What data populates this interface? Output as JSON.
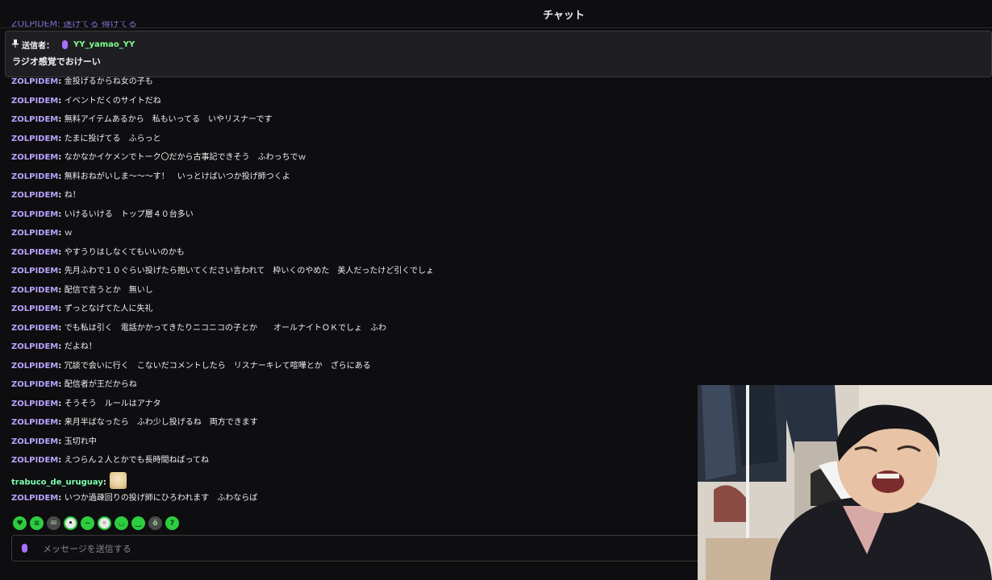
{
  "header": {
    "title": "チャット"
  },
  "clipped_top": "ZOLPIDEM: 迷げてる 得げてる",
  "pinned": {
    "icon": "pin-icon",
    "label": "送信者：",
    "username": "YY_yamao_YY",
    "message": "ラジオ感覚でおけーい"
  },
  "colors": {
    "zolpidem": "#b9a3ff",
    "trabuco": "#7dffb0",
    "pinned_user": "#7dff8b"
  },
  "messages": [
    {
      "user": "ZOLPIDEM",
      "text": "金投げるからね女の子も",
      "color": "#b9a3ff"
    },
    {
      "user": "ZOLPIDEM",
      "text": "イベントだくのサイトだね",
      "color": "#b9a3ff"
    },
    {
      "user": "ZOLPIDEM",
      "text": "無料アイテムあるから　私もいってる　いやリスナーです",
      "color": "#b9a3ff"
    },
    {
      "user": "ZOLPIDEM",
      "text": "たまに投げてる　ふらっと",
      "color": "#b9a3ff"
    },
    {
      "user": "ZOLPIDEM",
      "text": "なかなかイケメンでトーク〇だから古事記できそう　ふわっちでｗ",
      "color": "#b9a3ff"
    },
    {
      "user": "ZOLPIDEM",
      "text": "無料おねがいしま〜〜〜す！　いっとけばいつか投げ師つくよ",
      "color": "#b9a3ff"
    },
    {
      "user": "ZOLPIDEM",
      "text": "ね！",
      "color": "#b9a3ff"
    },
    {
      "user": "ZOLPIDEM",
      "text": "いけるいける　トップ層４０台多い",
      "color": "#b9a3ff"
    },
    {
      "user": "ZOLPIDEM",
      "text": "ｗ",
      "color": "#b9a3ff"
    },
    {
      "user": "ZOLPIDEM",
      "text": "やすうりはしなくてもいいのかも",
      "color": "#b9a3ff"
    },
    {
      "user": "ZOLPIDEM",
      "text": "先月ふわで１０ぐらい投げたら抱いてください言われて　枠いくのやめた　美人だったけど引くでしょ",
      "color": "#b9a3ff"
    },
    {
      "user": "ZOLPIDEM",
      "text": "配信で言うとか　無いし",
      "color": "#b9a3ff"
    },
    {
      "user": "ZOLPIDEM",
      "text": "ずっとなげてた人に失礼",
      "color": "#b9a3ff"
    },
    {
      "user": "ZOLPIDEM",
      "text": "でも私は引く　電話かかってきたりニコニコの子とか　　オールナイトＯＫでしょ　ふわ",
      "color": "#b9a3ff"
    },
    {
      "user": "ZOLPIDEM",
      "text": "だよね！",
      "color": "#b9a3ff"
    },
    {
      "user": "ZOLPIDEM",
      "text": "冗談で会いに行く　こないだコメントしたら　リスナーキレて喧嘩とか　ざらにある",
      "color": "#b9a3ff"
    },
    {
      "user": "ZOLPIDEM",
      "text": "配信者が王だからね",
      "color": "#b9a3ff"
    },
    {
      "user": "ZOLPIDEM",
      "text": "そうそう　ルールはアナタ",
      "color": "#b9a3ff"
    },
    {
      "user": "ZOLPIDEM",
      "text": "来月半ばなったら　ふわ少し投げるね　両方できます",
      "color": "#b9a3ff"
    },
    {
      "user": "ZOLPIDEM",
      "text": "玉切れ中",
      "color": "#b9a3ff"
    },
    {
      "user": "ZOLPIDEM",
      "text": "えつらん２人とかでも長時間ねばってね",
      "color": "#b9a3ff"
    },
    {
      "user": "trabuco_de_uruguay",
      "text": "",
      "color": "#7dffb0",
      "sticker": true
    },
    {
      "user": "ZOLPIDEM",
      "text": "いつか過疎回りの投げ師にひろわれます　ふわならば",
      "color": "#b9a3ff"
    }
  ],
  "emotes": [
    {
      "icon": "frog-heart-emote-icon",
      "glyph": "♥",
      "style": ""
    },
    {
      "icon": "frog-note-emote-icon",
      "glyph": "≡",
      "style": ""
    },
    {
      "icon": "letter-emote-icon",
      "glyph": "✉",
      "style": "dark"
    },
    {
      "icon": "ring-face-emote-icon",
      "glyph": "•",
      "style": "ring"
    },
    {
      "icon": "frog-chat-emote-icon",
      "glyph": "~",
      "style": ""
    },
    {
      "icon": "ring-wave-emote-icon",
      "glyph": "◦",
      "style": "ring"
    },
    {
      "icon": "frog-smile-emote-icon",
      "glyph": "◡",
      "style": ""
    },
    {
      "icon": "frog-bubble-emote-icon",
      "glyph": "‿",
      "style": ""
    },
    {
      "icon": "frog-dark-emote-icon",
      "glyph": "ö",
      "style": "dark"
    },
    {
      "icon": "frog-question-emote-icon",
      "glyph": "?",
      "style": ""
    }
  ],
  "input": {
    "placeholder": "メッセージを送信する"
  }
}
